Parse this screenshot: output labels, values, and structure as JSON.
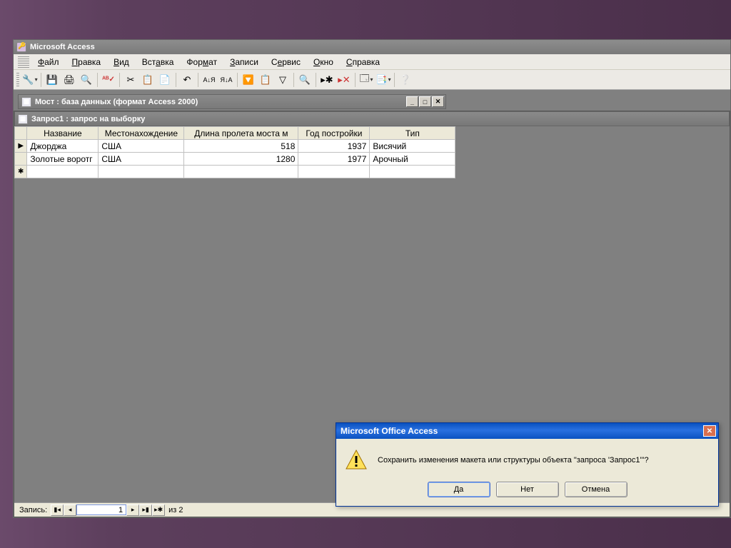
{
  "app": {
    "title": "Microsoft Access"
  },
  "menu": {
    "file": "Файл",
    "edit": "Правка",
    "view": "Вид",
    "insert": "Вставка",
    "format": "Формат",
    "records": "Записи",
    "tools": "Сервис",
    "window": "Окно",
    "help": "Справка"
  },
  "db_window": {
    "title": "Мост : база данных (формат Access 2000)"
  },
  "query_window": {
    "title": "Запрос1 : запрос на выборку"
  },
  "columns": [
    "Название",
    "Местонахождение",
    "Длина пролета моста м",
    "Год постройки",
    "Тип"
  ],
  "rows": [
    {
      "name": "Джорджа",
      "loc": "США",
      "span": 518,
      "year": 1937,
      "type": "Висячий"
    },
    {
      "name": "Золотые воротг",
      "loc": "США",
      "span": 1280,
      "year": 1977,
      "type": "Арочный"
    }
  ],
  "recordnav": {
    "label": "Запись:",
    "current": "1",
    "total_label": "из  2"
  },
  "dialog": {
    "title": "Microsoft Office Access",
    "message": "Сохранить изменения макета или структуры объекта \"запроса 'Запрос1'\"?",
    "yes": "Да",
    "no": "Нет",
    "cancel": "Отмена"
  }
}
